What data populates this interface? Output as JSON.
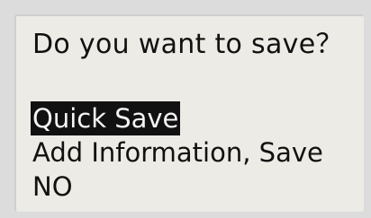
{
  "dialog": {
    "prompt": "Do you want to save？",
    "options": [
      {
        "label": "Quick Save",
        "selected": true
      },
      {
        "label": "Add Information, Save",
        "selected": false
      },
      {
        "label": "NO",
        "selected": false
      }
    ]
  },
  "colors": {
    "screen_background": "#ecebe5",
    "text": "#111111",
    "highlight_background": "#111111",
    "highlight_text": "#f4f4f4"
  }
}
